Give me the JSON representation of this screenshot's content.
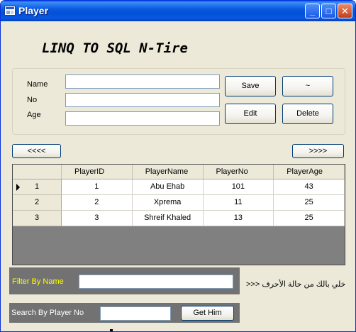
{
  "window": {
    "title": "Player",
    "icon": "app-form-icon",
    "buttons": {
      "minimize": "_",
      "maximize": "□",
      "close": "✕"
    }
  },
  "heading": "LINQ  TO  SQL  N-Tire",
  "form": {
    "name_label": "Name",
    "no_label": "No",
    "age_label": "Age",
    "name_value": "",
    "no_value": "",
    "age_value": ""
  },
  "buttons": {
    "save": "Save",
    "tilde": "~",
    "edit": "Edit",
    "delete": "Delete",
    "prev": "<<<<",
    "next": ">>>>",
    "get_him": "Get Him"
  },
  "grid": {
    "columns": [
      "PlayerID",
      "PlayerName",
      "PlayerNo",
      "PlayerAge"
    ],
    "rows": [
      {
        "header": "1",
        "current": true,
        "cells": [
          "1",
          "Abu Ehab",
          "101",
          "43"
        ]
      },
      {
        "header": "2",
        "current": false,
        "cells": [
          "2",
          "Xprema",
          "11",
          "25"
        ]
      },
      {
        "header": "3",
        "current": false,
        "cells": [
          "3",
          "Shreif Khaled",
          "13",
          "25"
        ]
      }
    ]
  },
  "filter": {
    "label": "Filter By Name",
    "value": "",
    "note": "خلي بالك من حالة الأحرف <<<"
  },
  "search": {
    "label": "Search By Player No",
    "value": ""
  },
  "colors": {
    "titlebar": "#0a5ae0",
    "form_background": "#ece9d8",
    "grid_background": "#808080",
    "panel_background": "#727272",
    "filter_label": "#ffff00"
  }
}
